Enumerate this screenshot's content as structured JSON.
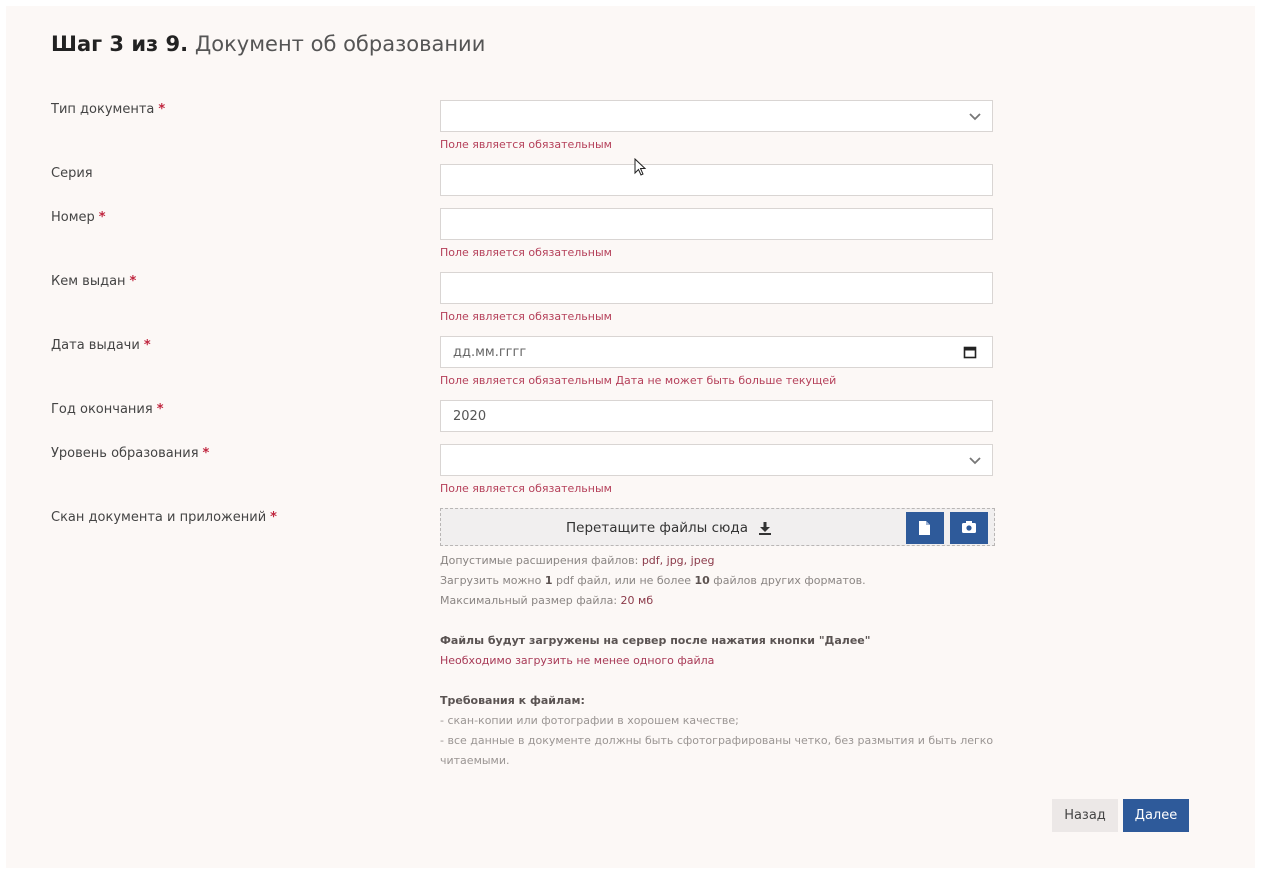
{
  "header": {
    "step": "Шаг 3 из 9.",
    "title": "Документ об образовании"
  },
  "required_mark": "*",
  "fields": {
    "doc_type": {
      "label": "Тип документа",
      "value": "",
      "error": "Поле является обязательным"
    },
    "series": {
      "label": "Серия",
      "value": ""
    },
    "number": {
      "label": "Номер",
      "value": "",
      "error": "Поле является обязательным"
    },
    "issued_by": {
      "label": "Кем выдан",
      "value": "",
      "error": "Поле является обязательным"
    },
    "issue_date": {
      "label": "Дата выдачи",
      "placeholder": "дд.мм.гггг",
      "error": "Поле является обязательным Дата не может быть больше текущей"
    },
    "grad_year": {
      "label": "Год окончания",
      "value": "2020"
    },
    "edu_level": {
      "label": "Уровень образования",
      "value": "",
      "error": "Поле является обязательным"
    },
    "scan": {
      "label": "Скан документа и приложений"
    }
  },
  "upload": {
    "drop_label": "Перетащите файлы сюда",
    "ext_prefix": "Допустимые расширения файлов:",
    "ext_value": "pdf, jpg, jpeg",
    "limit_a": "Загрузить можно",
    "limit_pdf_count": "1",
    "limit_b": "pdf файл, или не более",
    "limit_other_count": "10",
    "limit_c": "файлов других форматов.",
    "size_prefix": "Максимальный размер файла:",
    "size_value": "20 мб",
    "note_server": "Файлы будут загружены на сервер после нажатия кнопки \"Далее\"",
    "note_required": "Необходимо загрузить не менее одного файла",
    "requirements_title": "Требования к файлам:",
    "requirement_1": "- скан-копии или фотографии в хорошем качестве;",
    "requirement_2a": "- все данные в документе должны быть сфотографированы четко, без размытия и быть легко",
    "requirement_2b": "читаемыми."
  },
  "buttons": {
    "back": "Назад",
    "next": "Далее"
  },
  "colors": {
    "accent": "#2e5a9a",
    "error": "#b5405a",
    "required": "#c0263f"
  },
  "icons": [
    "chevron-down-icon",
    "calendar-icon",
    "download-icon",
    "file-icon",
    "camera-icon",
    "cursor-icon"
  ]
}
